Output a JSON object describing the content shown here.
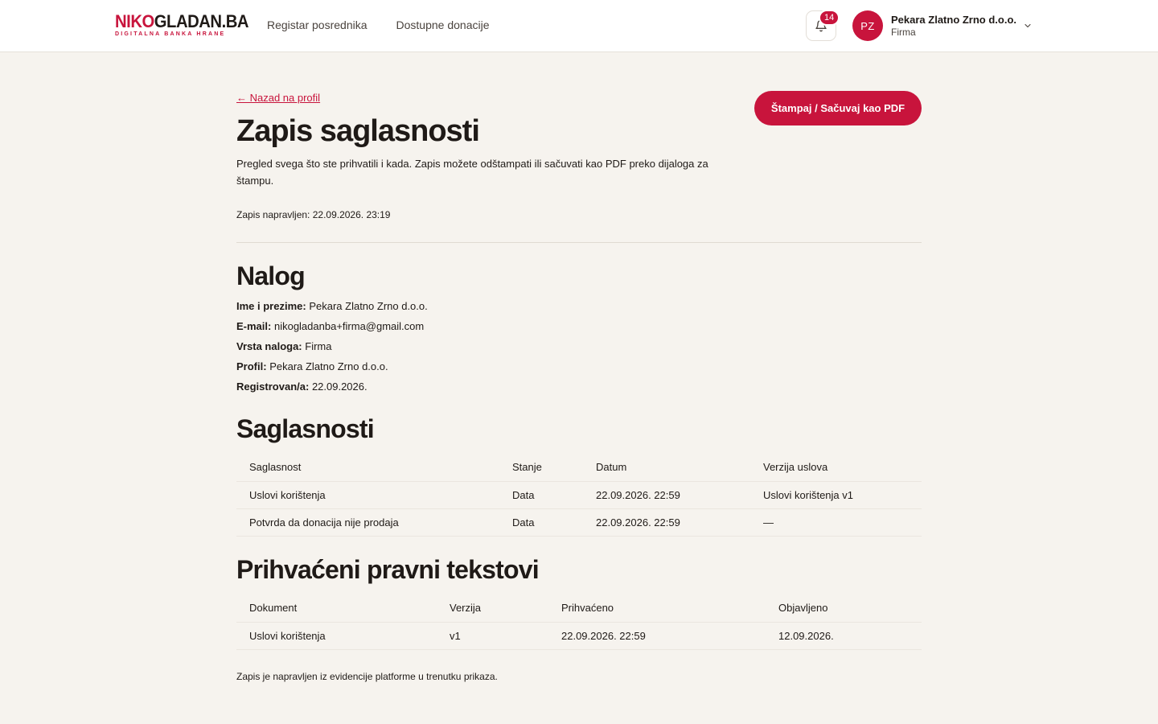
{
  "brand": {
    "logo_part1": "NIKO",
    "logo_part2": "GLADAN.BA",
    "logo_tagline": "DIGITALNA BANKA HRANE",
    "accent_color": "#c8143c"
  },
  "nav": {
    "items": [
      {
        "label": "Registar posrednika"
      },
      {
        "label": "Dostupne donacije"
      }
    ]
  },
  "header": {
    "notifications_count": "14",
    "notifications_icon": "bell-icon",
    "user_initials": "PZ",
    "user_name": "Pekara Zlatno Zrno d.o.o.",
    "user_role": "Firma",
    "menu_icon": "chevron-down-icon"
  },
  "page": {
    "back_link": "← Nazad na profil",
    "title": "Zapis saglasnosti",
    "intro": "Pregled svega što ste prihvatili i kada. Zapis možete odštampati ili sačuvati kao PDF preko dijaloga za štampu.",
    "generated_at": "Zapis napravljen: 22.09.2026. 23:19",
    "print_button": "Štampaj / Sačuvaj kao PDF",
    "footer_note": "Zapis je napravljen iz evidencije platforme u trenutku prikaza."
  },
  "account": {
    "heading": "Nalog",
    "rows": [
      {
        "label": "Ime i prezime:",
        "value": "Pekara Zlatno Zrno d.o.o."
      },
      {
        "label": "E-mail:",
        "value": "nikogladanba+firma@gmail.com"
      },
      {
        "label": "Vrsta naloga:",
        "value": "Firma"
      },
      {
        "label": "Profil:",
        "value": "Pekara Zlatno Zrno d.o.o."
      },
      {
        "label": "Registrovan/a:",
        "value": "22.09.2026."
      }
    ]
  },
  "consents": {
    "heading": "Saglasnosti",
    "columns": [
      "Saglasnost",
      "Stanje",
      "Datum",
      "Verzija uslova"
    ],
    "rows": [
      [
        "Uslovi korištenja",
        "Data",
        "22.09.2026. 22:59",
        "Uslovi korištenja v1"
      ],
      [
        "Potvrda da donacija nije prodaja",
        "Data",
        "22.09.2026. 22:59",
        "—"
      ]
    ]
  },
  "legal": {
    "heading": "Prihvaćeni pravni tekstovi",
    "columns": [
      "Dokument",
      "Verzija",
      "Prihvaćeno",
      "Objavljeno"
    ],
    "rows": [
      [
        "Uslovi korištenja",
        "v1",
        "22.09.2026. 22:59",
        "12.09.2026."
      ]
    ]
  }
}
